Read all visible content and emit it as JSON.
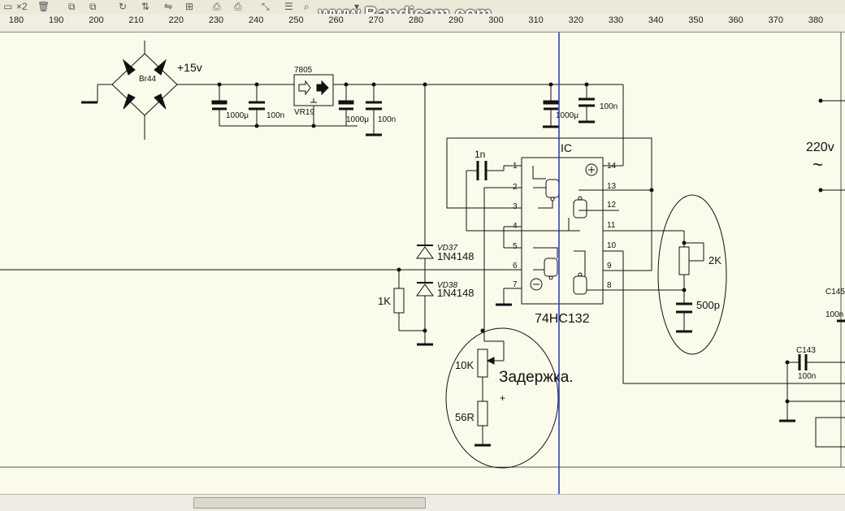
{
  "toolbar": {
    "zoom_label": "×2"
  },
  "watermark": "www.Bandicam.com",
  "ruler": {
    "ticks": [
      "180",
      "190",
      "200",
      "210",
      "220",
      "230",
      "240",
      "250",
      "260",
      "270",
      "280",
      "290",
      "300",
      "310",
      "320",
      "330",
      "340",
      "350",
      "360",
      "370",
      "380"
    ]
  },
  "schematic": {
    "bridge": "Br44",
    "plus15v": "+15v",
    "reg_type": "7805",
    "reg_name": "VR19",
    "cap_1000u": "1000μ",
    "cap_100n": "100n",
    "ic_label": "IC",
    "ic_part": "74HC132",
    "pins": [
      "1",
      "2",
      "3",
      "4",
      "5",
      "6",
      "7",
      "8",
      "9",
      "10",
      "11",
      "12",
      "13",
      "14"
    ],
    "cap_1n": "1n",
    "vd37": "VD37",
    "vd38": "VD38",
    "diode_type": "1N4148",
    "r_1k": "1K",
    "r_10k": "10K",
    "r_56r": "56R",
    "delay_label": "Задержка.",
    "r_2k": "2K",
    "cap_500p": "500p",
    "mains": "220v",
    "mains_symbol": "~",
    "c145": "C145",
    "c143": "C143",
    "cap_100n_trunc": "100n"
  }
}
